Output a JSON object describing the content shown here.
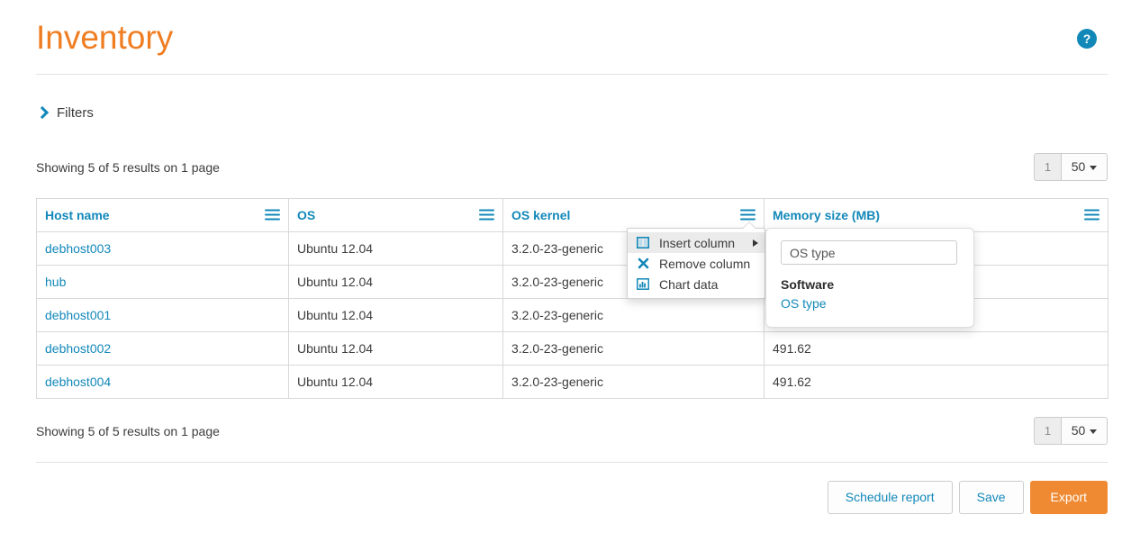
{
  "header": {
    "title": "Inventory",
    "help_icon": "help-circle-icon",
    "help_glyph": "?"
  },
  "filters": {
    "label": "Filters",
    "icon": "chevron-right-icon",
    "expanded": false
  },
  "results": {
    "top_text": "Showing 5 of 5 results on 1 page",
    "bottom_text": "Showing 5 of 5 results on 1 page"
  },
  "pagination": {
    "current_page": "1",
    "page_size": "50",
    "caret_icon": "caret-down-icon"
  },
  "table": {
    "columns": [
      {
        "label": "Host name",
        "menu_icon": "hamburger-menu-icon"
      },
      {
        "label": "OS",
        "menu_icon": "hamburger-menu-icon"
      },
      {
        "label": "OS kernel",
        "menu_icon": "hamburger-menu-icon"
      },
      {
        "label": "Memory size (MB)",
        "menu_icon": "hamburger-menu-icon"
      }
    ],
    "rows": [
      {
        "host_name": "debhost003",
        "os": "Ubuntu 12.04",
        "os_kernel": "3.2.0-23-generic",
        "memory_size": ""
      },
      {
        "host_name": "hub",
        "os": "Ubuntu 12.04",
        "os_kernel": "3.2.0-23-generic",
        "memory_size": ""
      },
      {
        "host_name": "debhost001",
        "os": "Ubuntu 12.04",
        "os_kernel": "3.2.0-23-generic",
        "memory_size": ""
      },
      {
        "host_name": "debhost002",
        "os": "Ubuntu 12.04",
        "os_kernel": "3.2.0-23-generic",
        "memory_size": "491.62"
      },
      {
        "host_name": "debhost004",
        "os": "Ubuntu 12.04",
        "os_kernel": "3.2.0-23-generic",
        "memory_size": "491.62"
      }
    ]
  },
  "column_menu": {
    "open_for_column": "OS kernel",
    "items": [
      {
        "label": "Insert column",
        "icon": "columns-icon",
        "active": true,
        "has_submenu": true
      },
      {
        "label": "Remove column",
        "icon": "times-icon",
        "active": false,
        "has_submenu": false
      },
      {
        "label": "Chart data",
        "icon": "bar-chart-icon",
        "active": false,
        "has_submenu": false
      }
    ]
  },
  "insert_column_submenu": {
    "search_value": "OS type",
    "search_placeholder": "OS type",
    "group_title": "Software",
    "options": [
      {
        "label": "OS type"
      }
    ]
  },
  "footer": {
    "schedule_report_label": "Schedule report",
    "save_label": "Save",
    "export_label": "Export"
  },
  "colors": {
    "brand_orange": "#ef7d22",
    "export_orange": "#ef8a32",
    "link_blue": "#1288b9",
    "text_dark": "#3c3c3c",
    "border_grey": "#d8d8d8",
    "menu_highlight": "#ebebeb"
  }
}
